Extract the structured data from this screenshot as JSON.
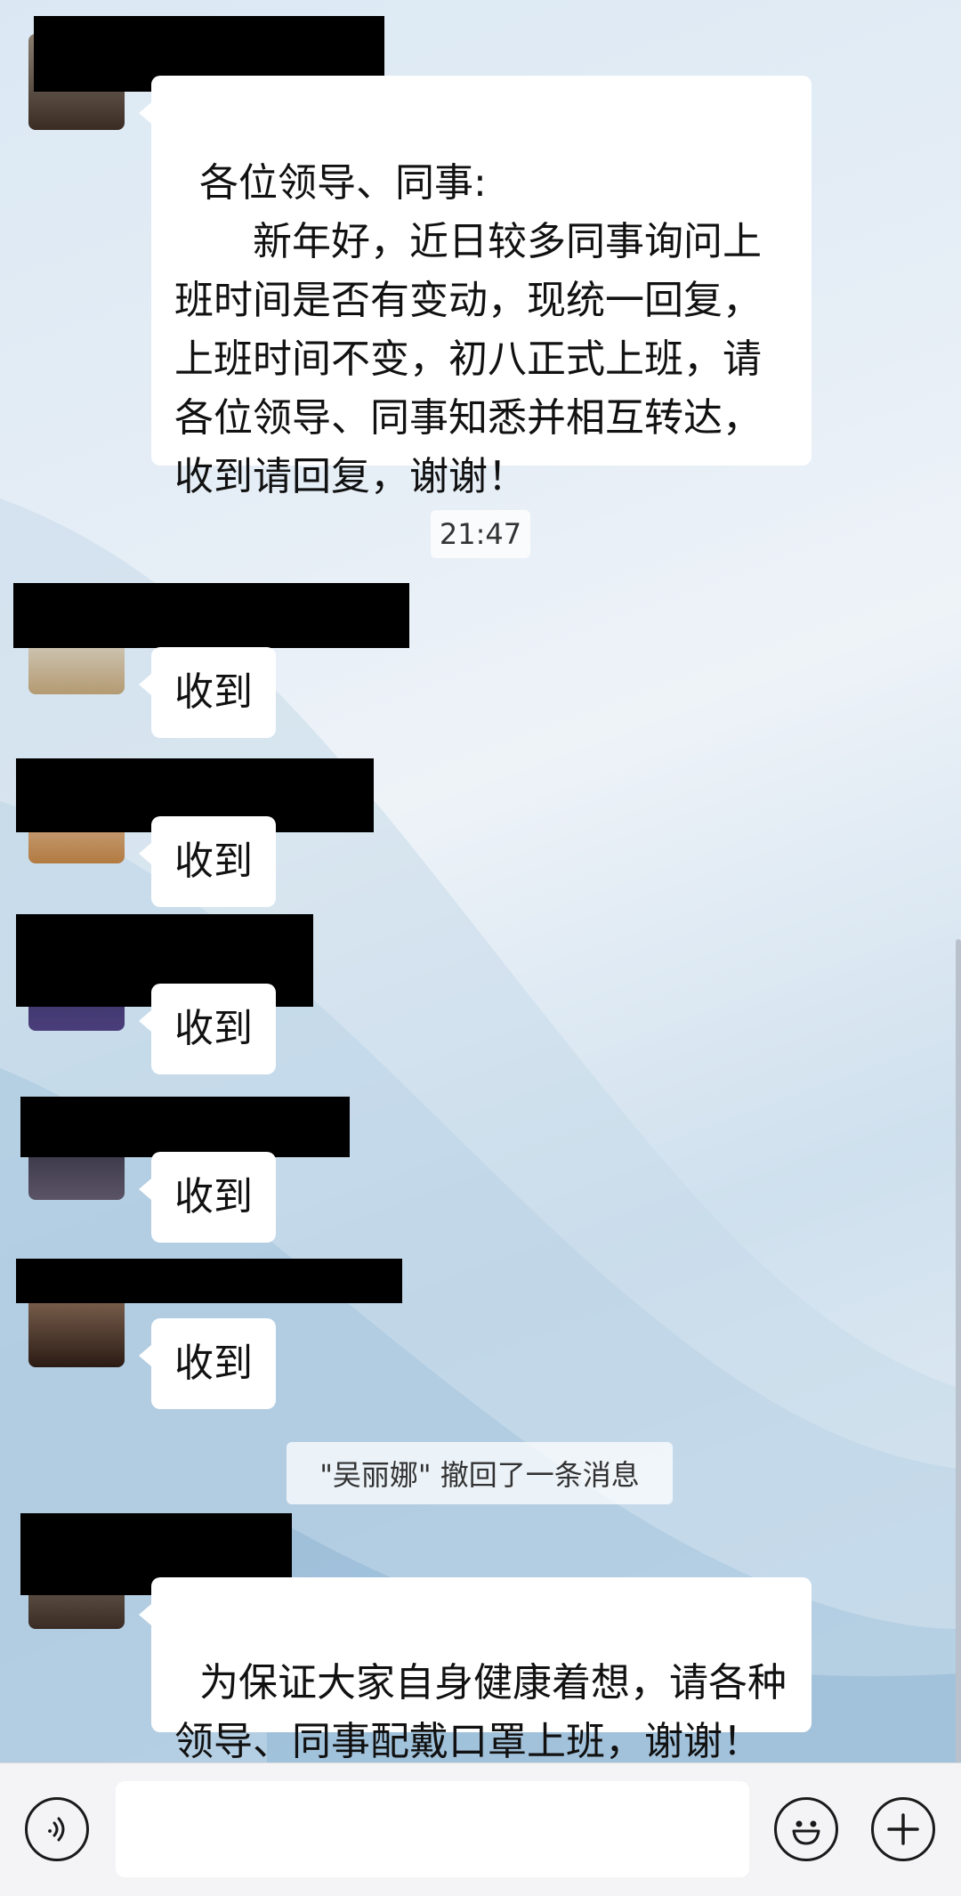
{
  "messages": {
    "notice": "各位领导、同事:\n　　新年好，近日较多同事询问上\n班时间是否有变动，现统一回复，\n上班时间不变，初八正式上班，请\n各位领导、同事知悉并相互转达，\n收到请回复，谢谢！",
    "timestamp": "21:47",
    "replies": [
      "收到",
      "收到",
      "收到",
      "收到",
      "收到"
    ],
    "recall_notice": "\"吴丽娜\" 撤回了一条消息",
    "mask_notice": "为保证大家自身健康着想，请各种\n领导、同事配戴口罩上班，谢谢！"
  },
  "input": {
    "value": "",
    "placeholder": ""
  },
  "icons": {
    "voice": "voice-icon",
    "emoji": "emoji-icon",
    "plus": "plus-icon"
  },
  "colors": {
    "bubble": "#ffffff",
    "redaction": "#000000",
    "background": "#dde9f3",
    "input_bar": "#f4f4f6"
  }
}
